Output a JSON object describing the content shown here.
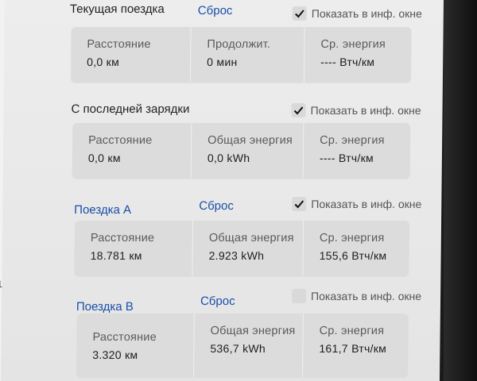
{
  "current_trip": {
    "title": "Текущая поездка",
    "reset": "Сброс",
    "show_label": "Показать в инф. окне",
    "show_checked": true,
    "stats": [
      {
        "label": "Расстояние",
        "value": "0,0 км"
      },
      {
        "label": "Продолжит.",
        "value": "0 мин"
      },
      {
        "label": "Ср. энергия",
        "value": "---- Втч/км"
      }
    ]
  },
  "since_charge": {
    "title": "С последней зарядки",
    "show_label": "Показать в инф. окне",
    "show_checked": true,
    "stats": [
      {
        "label": "Расстояние",
        "value": "0,0 км"
      },
      {
        "label": "Общая энергия",
        "value": "0,0 kWh"
      },
      {
        "label": "Ср. энергия",
        "value": "---- Втч/км"
      }
    ]
  },
  "trip_a": {
    "title": "Поездка A",
    "reset": "Сброс",
    "show_label": "Показать в инф. окне",
    "show_checked": true,
    "stats": [
      {
        "label": "Расстояние",
        "value": "18.781 км"
      },
      {
        "label": "Общая энергия",
        "value": "2.923 kWh"
      },
      {
        "label": "Ср. энергия",
        "value": "155,6 Втч/км"
      }
    ]
  },
  "trip_b": {
    "title": "Поездка B",
    "reset": "Сброс",
    "show_label": "Показать в инф. окне",
    "show_checked": false,
    "stats": [
      {
        "label": "Расстояние",
        "value": "3.320 км"
      },
      {
        "label": "Общая энергия",
        "value": "536,7 kWh"
      },
      {
        "label": "Ср. энергия",
        "value": "161,7 Втч/км"
      }
    ]
  },
  "edge_mark": "1",
  "colors": {
    "link_blue": "#1b4fa8",
    "card_bg": "#dcdcdc",
    "screen_bg": "#ececec"
  }
}
